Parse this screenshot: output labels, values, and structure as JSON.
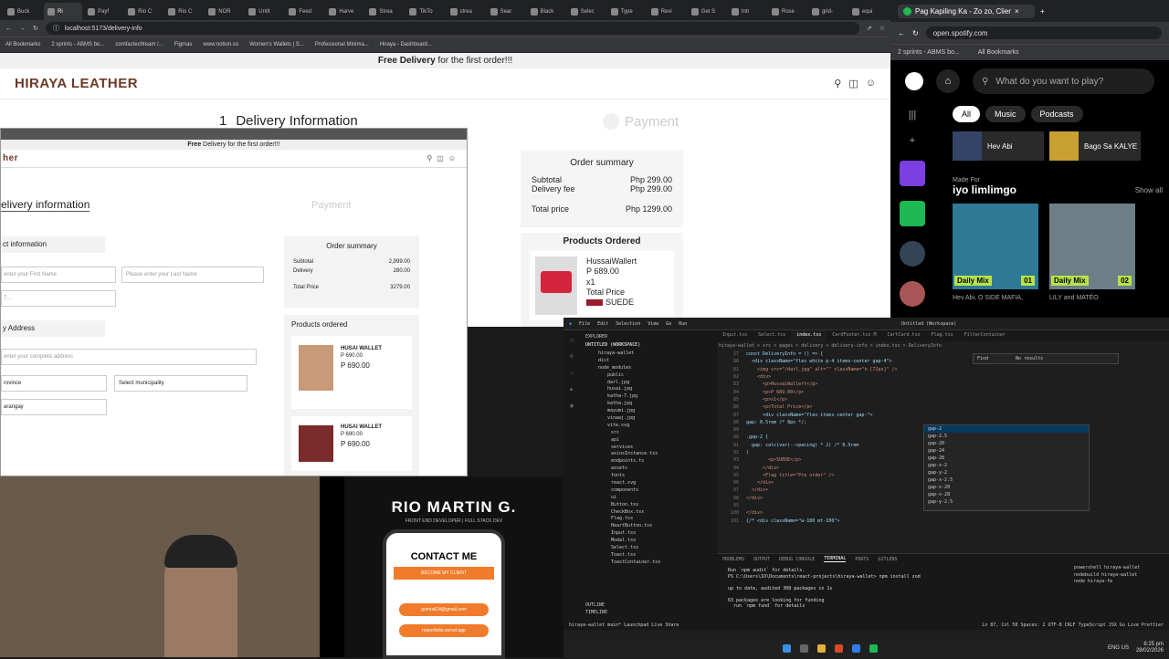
{
  "browser": {
    "tabs": [
      {
        "label": "Buck",
        "active": false
      },
      {
        "label": "Ri",
        "active": true
      },
      {
        "label": "Payf",
        "active": false
      },
      {
        "label": "Rio C",
        "active": false
      },
      {
        "label": "Rio C",
        "active": false
      },
      {
        "label": "NOR",
        "active": false
      },
      {
        "label": "Untit",
        "active": false
      },
      {
        "label": "Feed",
        "active": false
      },
      {
        "label": "Harve",
        "active": false
      },
      {
        "label": "Strea",
        "active": false
      },
      {
        "label": "TikTo",
        "active": false
      },
      {
        "label": "strea",
        "active": false
      },
      {
        "label": "Sear",
        "active": false
      },
      {
        "label": "Black",
        "active": false
      },
      {
        "label": "Selec",
        "active": false
      },
      {
        "label": "Type",
        "active": false
      },
      {
        "label": "Revi",
        "active": false
      },
      {
        "label": "Get S",
        "active": false
      },
      {
        "label": "Intr",
        "active": false
      },
      {
        "label": "Rose",
        "active": false
      },
      {
        "label": "grid-",
        "active": false
      },
      {
        "label": "equi",
        "active": false
      }
    ],
    "url": "localhost:5173/delivery-info",
    "bookmarks": [
      "All Bookmarks",
      "2 sprints - ABMS bo...",
      "comfactechteam /...",
      "Figmas",
      "www.notion.so",
      "Women's Wallets | S...",
      "Professional Minima...",
      "Hiraya - Dashboard..."
    ]
  },
  "site": {
    "banner_bold": "Free Delivery",
    "banner_rest": " for the first order!!!",
    "brand": "HIRAYA LEATHER",
    "step1_num": "1",
    "step1": "Delivery Information",
    "step2": "Payment",
    "summary": {
      "title": "Order summary",
      "subtotal_l": "Subtotal",
      "subtotal_v": "Php 299.00",
      "fee_l": "Delivery fee",
      "fee_v": "Php 299.00",
      "total_l": "Total price",
      "total_v": "Php 1299.00"
    },
    "products": {
      "title": "Products Ordered",
      "name": "HussaiWallert",
      "price": "P 689.00",
      "qty": "x1",
      "total": "Total Price",
      "variant": "SUEDE"
    }
  },
  "overlay": {
    "banner_bold": "Free",
    "banner_rest": " Delivery for the first order!!!",
    "brand": "her",
    "heading": "elivery information",
    "payment": "Payment",
    "contact": "ct information",
    "first_ph": "enter your First Name",
    "last_ph": "Please enter your Last Name",
    "phone_ph": "7...",
    "address": "y Address",
    "address_ph": "enter your complete address",
    "province": "rovince",
    "municipality": "Select municipality",
    "barangay": "arangay",
    "summary": {
      "title": "Order summary",
      "subtotal_l": "Subtotal",
      "subtotal_v": "2,999.00",
      "fee_l": "Delivery",
      "fee_v": "280.00",
      "total_l": "Total Price",
      "total_v": "3279.00"
    },
    "products_title": "Products ordered",
    "p1": {
      "name": "HUSAI WALLET",
      "price": "P 690.00",
      "price2": "P 690.00"
    },
    "p2": {
      "name": "HUSAI WALLET",
      "price": "P 690.00",
      "price2": "P 690.00"
    }
  },
  "spotify": {
    "tab_title": "Pag Kapiling Ka - Zo zo, Clier",
    "url": "open.spotify.com",
    "bookmarks": [
      "2 sprints - ABMS bo...",
      "All Bookmarks"
    ],
    "search_ph": "What do you want to play?",
    "chips": [
      "All",
      "Music",
      "Podcasts"
    ],
    "card1": "Hev Abi",
    "card2": "Bago Sa KALYE",
    "made_for": "Made For",
    "user": "iyo limlimgo",
    "show_all": "Show all",
    "mix1": "Daily Mix",
    "mix1_num": "01",
    "mix2": "Daily Mix",
    "mix2_num": "02",
    "mix1_sub": "Hev Abi, O SIDE MAFIA,",
    "mix2_sub": "LILY and MATÉO"
  },
  "camera": {
    "name": "RIO MARTIN G.",
    "role": "FRONT END DEVELOPER | FULL STACK DEV",
    "contact": "CONTACT ME",
    "client": "BECOME MY CLIENT",
    "email": "gotmail14@gmail.com",
    "site": "rioportfolio.vercel.app"
  },
  "vscode": {
    "menu": [
      "File",
      "Edit",
      "Selection",
      "View",
      "Go",
      "Run"
    ],
    "title": "Untitled (Workspace)",
    "explorer": "EXPLORER",
    "workspace": "UNTITLED (WORKSPACE)",
    "tree": [
      "hiraya-wallet",
      "dist",
      "node_modules",
      "public",
      "darl.jpg",
      "husai.jpg",
      "katha-7.jpg",
      "katha.jpg",
      "mayumi.jpg",
      "vinaaj.jpg",
      "vite.svg",
      "src",
      "api",
      "services",
      "axiosInstance.tsx",
      "endpoints.ts",
      "assets",
      "fonts",
      "react.svg",
      "components",
      "ui",
      "Button.tsx",
      "CheckBox.tsx",
      "Flag.tsx",
      "HeartButton.tsx",
      "Input.tsx",
      "Modal.tsx",
      "Select.tsx",
      "Toast.tsx",
      "ToastContainer.tsx"
    ],
    "tabs": [
      "Input.tsx",
      "Select.tsx",
      "index.tsx",
      "CardFooter.tsx M",
      "CartCard.tsx",
      "Flag.tsx",
      "FilterContainer"
    ],
    "breadcrumb": "hiraya-wallet > src > pages > delivery > delivery-info > index.tsx > DeliveryInfo",
    "find": "Find",
    "no_results": "No results",
    "lines": [
      {
        "n": "27",
        "t": "const DeliveryInfo = () => {"
      },
      {
        "n": "80",
        "t": "  <div className=\"flex white p-4 items-center gap-4\">"
      },
      {
        "n": "81",
        "t": "    <img src=\"/darl.jpg\" alt=\"\" className=\"h-[72px]\" />"
      },
      {
        "n": "82",
        "t": "    <div>"
      },
      {
        "n": "83",
        "t": "      <p>HussaiWallert</p>"
      },
      {
        "n": "84",
        "t": "      <p>P 689.00</p>"
      },
      {
        "n": "85",
        "t": "      <p>x1</p>"
      },
      {
        "n": "86",
        "t": "      <p>Total Price</p>"
      },
      {
        "n": "87",
        "t": "      <div className=\"flex items-center gap-\">"
      },
      {
        "n": "88",
        "t": "gap: 0.5rem /* 8px */;"
      },
      {
        "n": "89",
        "t": ""
      },
      {
        "n": "90",
        "t": ".gap-2 {"
      },
      {
        "n": "91",
        "t": "  gap: calc(var(--spacing) * 2) /* 0.5rem"
      },
      {
        "n": "92",
        "t": "}"
      },
      {
        "n": "93",
        "t": "        <p>SUEDE</p>"
      },
      {
        "n": "94",
        "t": "      </div>"
      },
      {
        "n": "95",
        "t": "      <Flag title=\"Pre order\" />"
      },
      {
        "n": "96",
        "t": "    </div>"
      },
      {
        "n": "97",
        "t": "  </div>"
      },
      {
        "n": "98",
        "t": "</div>"
      },
      {
        "n": "99",
        "t": ""
      },
      {
        "n": "100",
        "t": "</div>"
      },
      {
        "n": "101",
        "t": "{/* <div className=\"w-100 mt-100\">"
      }
    ],
    "suggest": [
      "gap-2",
      "gap-2.5",
      "gap-20",
      "gap-24",
      "gap-28",
      "gap-x-2",
      "gap-y-2",
      "gap-x-2.5",
      "gap-x-20",
      "gap-x-28",
      "gap-y-2.5"
    ],
    "panel_tabs": [
      "PROBLEMS",
      "OUTPUT",
      "DEBUG CONSOLE",
      "TERMINAL",
      "PORTS",
      "GITLENS"
    ],
    "terminal": [
      "Run `npm audit` for details.",
      "PS C:\\Users\\IO\\Documents\\react-projects\\hiraya-wallet> npm install zod",
      "",
      "up to date, audited 308 packages in 1s",
      "",
      "63 packages are looking for funding",
      "  run `npm fund` for details"
    ],
    "terms": [
      "powershell hiraya-wallet",
      "nodebuild hiraya-wallet",
      "node hiraya-fe"
    ],
    "outline": "OUTLINE",
    "timeline": "TIMELINE",
    "status_left": "hiraya-wallet  main*  Launchpad  Live Share",
    "status_right": "Ln 87, Col 58  Spaces: 2  UTF-8  CRLF  TypeScript JSX  Go Live  Prettier"
  },
  "taskbar": {
    "lang": "ENG US",
    "time": "6:25 pm",
    "date": "28/02/2026"
  }
}
